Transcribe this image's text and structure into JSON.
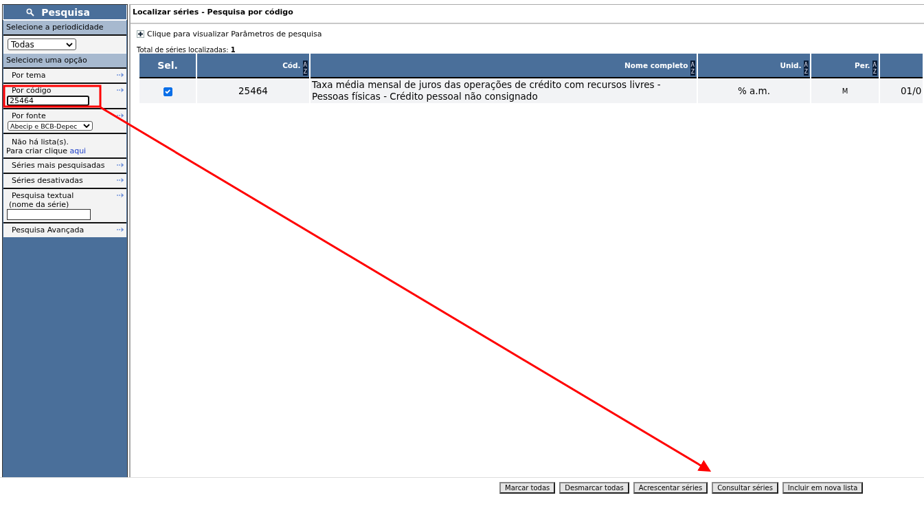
{
  "sidebar": {
    "title": "Pesquisa",
    "items": [
      {
        "kind": "section",
        "label": "Selecione a periodicidade"
      },
      {
        "kind": "select",
        "value": "Todas"
      },
      {
        "kind": "section",
        "label": "Selecione uma opção"
      },
      {
        "kind": "link",
        "label": "Por tema"
      },
      {
        "kind": "link-input",
        "label": "Por código",
        "value": "25464"
      },
      {
        "kind": "link-select",
        "label": "Por fonte",
        "value": "Abecip e BCB-Depec"
      },
      {
        "kind": "note",
        "text": "Não há lista(s).",
        "prompt": "Para criar clique",
        "link": "aqui"
      },
      {
        "kind": "link",
        "label": "Séries mais pesquisadas"
      },
      {
        "kind": "link",
        "label": "Séries desativadas"
      },
      {
        "kind": "link-input",
        "label": "Pesquisa textual",
        "sublabel": "(nome da série)"
      },
      {
        "kind": "link",
        "label": "Pesquisa Avançada"
      }
    ]
  },
  "main": {
    "title": "Localizar séries - Pesquisa por código",
    "expander": "Clique para visualizar Parâmetros de pesquisa",
    "total_label": "Total de séries localizadas:",
    "total": "1",
    "table": {
      "columns": [
        {
          "label": "Sel."
        },
        {
          "label": "Cód.",
          "sort": "AZ"
        },
        {
          "label": "Nome completo",
          "sort": "AZ"
        },
        {
          "label": "Unid.",
          "sort": "AZ"
        },
        {
          "label": "Per.",
          "sort": "AZ"
        },
        {}
      ],
      "rows": [
        {
          "selected": true,
          "cells": [
            "",
            "25464",
            "Taxa média mensal de juros das operações de crédito com recursos livres - Pessoas físicas - Crédito pessoal não consignado",
            "% a.m.",
            "M",
            "01/0"
          ]
        }
      ]
    }
  },
  "buttons": [
    "Marcar todas",
    "Desmarcar todas",
    "Acrescentar séries",
    "Consultar séries",
    "Incluir em nova lista"
  ]
}
